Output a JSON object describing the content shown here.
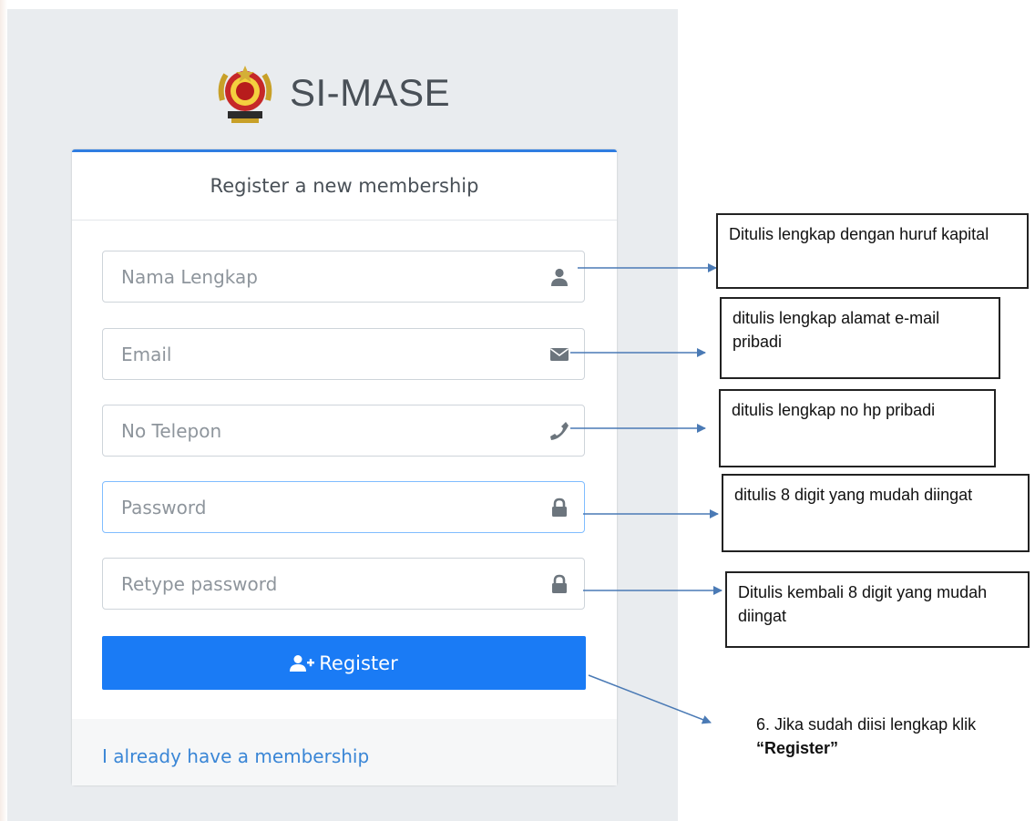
{
  "brand": {
    "title": "SI-MASE",
    "logo_icon": "emblem-logo-icon"
  },
  "card": {
    "heading": "Register a new membership",
    "fields": {
      "name": {
        "placeholder": "Nama Lengkap",
        "icon": "user-icon"
      },
      "email": {
        "placeholder": "Email",
        "icon": "envelope-icon"
      },
      "phone": {
        "placeholder": "No Telepon",
        "icon": "phone-icon"
      },
      "password": {
        "placeholder": "Password",
        "icon": "lock-icon"
      },
      "retype": {
        "placeholder": "Retype password",
        "icon": "lock-icon"
      }
    },
    "register_label": "Register",
    "register_icon": "user-plus-icon",
    "login_link": "I already have a membership"
  },
  "annotations": {
    "name": "Ditulis lengkap dengan huruf kapital",
    "email": "ditulis lengkap alamat e-mail pribadi",
    "phone": "ditulis lengkap  no hp pribadi",
    "password": "ditulis 8 digit yang mudah diingat",
    "retype": "Ditulis kembali  8 digit yang mudah diingat",
    "register_prefix": "6. Jika sudah diisi  lengkap klik ",
    "register_bold": "“Register”"
  },
  "colors": {
    "accent": "#1a7bf5",
    "link": "#3a86d6",
    "panel": "#e9ecef"
  }
}
